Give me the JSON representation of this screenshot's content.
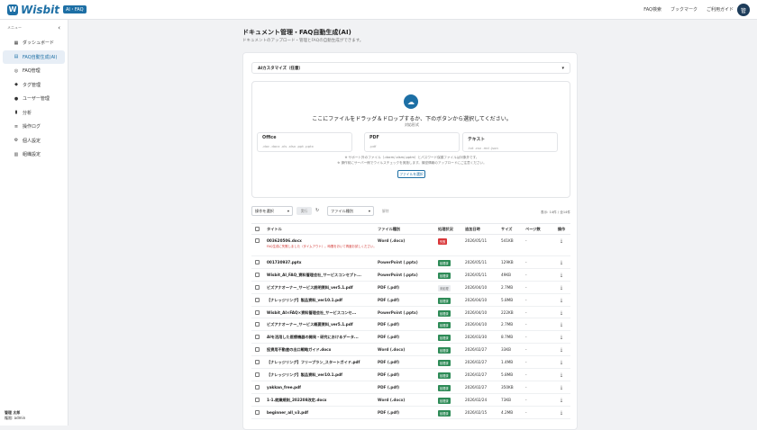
{
  "colors": {
    "accent": "#1d6fa5",
    "success": "#2e8b57",
    "error": "#d9373a",
    "unprocessed": "#e9ebee"
  },
  "header": {
    "logo_text": "Wisbit",
    "logo_badge": "AI・FAQ",
    "links": [
      "FAQ検索",
      "ブックマーク",
      "ご利用ガイド"
    ],
    "avatar_text": "管"
  },
  "sidebar": {
    "heading": "メニュー",
    "collapse_icon": "chevron-left-icon",
    "items": [
      {
        "label": "ダッシュボード",
        "icon": "dashboard-icon"
      },
      {
        "label": "FAQ自動生成(AI)",
        "icon": "document-icon",
        "active": true
      },
      {
        "label": "FAQ管理",
        "icon": "chat-icon"
      },
      {
        "label": "タグ管理",
        "icon": "tag-icon"
      },
      {
        "label": "ユーザー管理",
        "icon": "user-icon"
      },
      {
        "label": "分析",
        "icon": "chart-icon"
      },
      {
        "label": "操作ログ",
        "icon": "log-icon"
      },
      {
        "label": "個人設定",
        "icon": "settings-icon"
      },
      {
        "label": "組織設定",
        "icon": "building-icon"
      }
    ],
    "user_name": "管理 太郎",
    "user_role": "権限: admin"
  },
  "page": {
    "title": "ドキュメント管理・FAQ自動生成(AI)",
    "subtitle": "ドキュメントのアップロード・管理とFAQの自動生成ができます。"
  },
  "customize": {
    "label": "AIカスタマイズ（任意）"
  },
  "upload": {
    "main_text": "ここにファイルをドラッグ＆ドロップするか、下のボタンから選択してください。",
    "formats_label": "対応形式",
    "formats": [
      {
        "title": "Office",
        "exts": ".doc .docx .xls .xlsx .ppt .pptx"
      },
      {
        "title": "PDF",
        "exts": ".pdf"
      },
      {
        "title": "テキスト",
        "exts": ".txt .csv .md .json"
      }
    ],
    "note1": "※ サポート外のファイル（.docm/.xlsm/.pptm）とパスワード保護ファイルは対象外です。",
    "note2": "※ 操作前にサーバー側でウイルスチェックを実施します。機密情報のアップロードにご注意ください。",
    "button": "ファイルを選択"
  },
  "toolbar": {
    "action_select": "操作を選択",
    "execute": "実行",
    "filter_select": "ファイル種別",
    "clear": "解除",
    "count": "表示: 14件 / 全14件"
  },
  "table": {
    "headers": [
      "タイトル",
      "ファイル種別",
      "処理状況",
      "追加日時",
      "サイズ",
      "ページ数",
      "操作"
    ],
    "rows": [
      {
        "title": "003620506.docx",
        "type": "Word (.docx)",
        "status": "失敗",
        "status_kind": "error",
        "date": "2026/05/11",
        "size": "541KB",
        "pages": "-",
        "error": "FAQ生成に失敗しました（タイムアウト）。時間をおいて再度お試しください。"
      },
      {
        "title": "001730937.pptx",
        "type": "PowerPoint (.pptx)",
        "status": "処理済",
        "status_kind": "success",
        "date": "2026/05/11",
        "size": "129KB",
        "pages": "-"
      },
      {
        "title": "Wisbit_AI_FAQ_資料管理会社_サービスコンセプト...",
        "type": "PowerPoint (.pptx)",
        "status": "処理済",
        "status_kind": "success",
        "date": "2026/05/11",
        "size": "49KB",
        "pages": "-"
      },
      {
        "title": "ビズアナオーナー_サービス説明資料_ver5.1.pdf",
        "type": "PDF (.pdf)",
        "status": "未処理",
        "status_kind": "pending",
        "date": "2026/04/10",
        "size": "2.7MB",
        "pages": "-"
      },
      {
        "title": "【ナレッジリング】製品資料_ver10.1.pdf",
        "type": "PDF (.pdf)",
        "status": "処理済",
        "status_kind": "success",
        "date": "2026/04/10",
        "size": "5.8MB",
        "pages": "-"
      },
      {
        "title": "Wisbit_AI×FAQ×資料管理会社_サービスコンセ...",
        "type": "PowerPoint (.pptx)",
        "status": "処理済",
        "status_kind": "success",
        "date": "2026/04/10",
        "size": "222KB",
        "pages": "-"
      },
      {
        "title": "ビズアナオーナー_サービス概要資料_ver5.1.pdf",
        "type": "PDF (.pdf)",
        "status": "処理済",
        "status_kind": "success",
        "date": "2026/04/10",
        "size": "2.7MB",
        "pages": "-"
      },
      {
        "title": "AIを活用した医療機器の開発・研究におけるデータ...",
        "type": "PDF (.pdf)",
        "status": "処理済",
        "status_kind": "success",
        "date": "2026/03/30",
        "size": "8.7MB",
        "pages": "-"
      },
      {
        "title": "投資用不動産の出口戦略ガイド.docx",
        "type": "Word (.docx)",
        "status": "処理済",
        "status_kind": "success",
        "date": "2026/02/27",
        "size": "33KB",
        "pages": "-"
      },
      {
        "title": "【ナレッジリング】フリープラン_スタートガイド.pdf",
        "type": "PDF (.pdf)",
        "status": "処理済",
        "status_kind": "success",
        "date": "2026/02/27",
        "size": "1.4MB",
        "pages": "-"
      },
      {
        "title": "【ナレッジリング】製品資料_ver10.1.pdf",
        "type": "PDF (.pdf)",
        "status": "処理済",
        "status_kind": "success",
        "date": "2026/02/27",
        "size": "5.8MB",
        "pages": "-"
      },
      {
        "title": "yakkan_free.pdf",
        "type": "PDF (.pdf)",
        "status": "処理済",
        "status_kind": "success",
        "date": "2026/02/27",
        "size": "350KB",
        "pages": "-"
      },
      {
        "title": "1-1.就業規則_202208改定.docx",
        "type": "Word (.docx)",
        "status": "処理済",
        "status_kind": "success",
        "date": "2026/02/24",
        "size": "73KB",
        "pages": "-"
      },
      {
        "title": "beginner_all_v3.pdf",
        "type": "PDF (.pdf)",
        "status": "処理済",
        "status_kind": "success",
        "date": "2026/02/15",
        "size": "4.2MB",
        "pages": "-"
      }
    ]
  }
}
